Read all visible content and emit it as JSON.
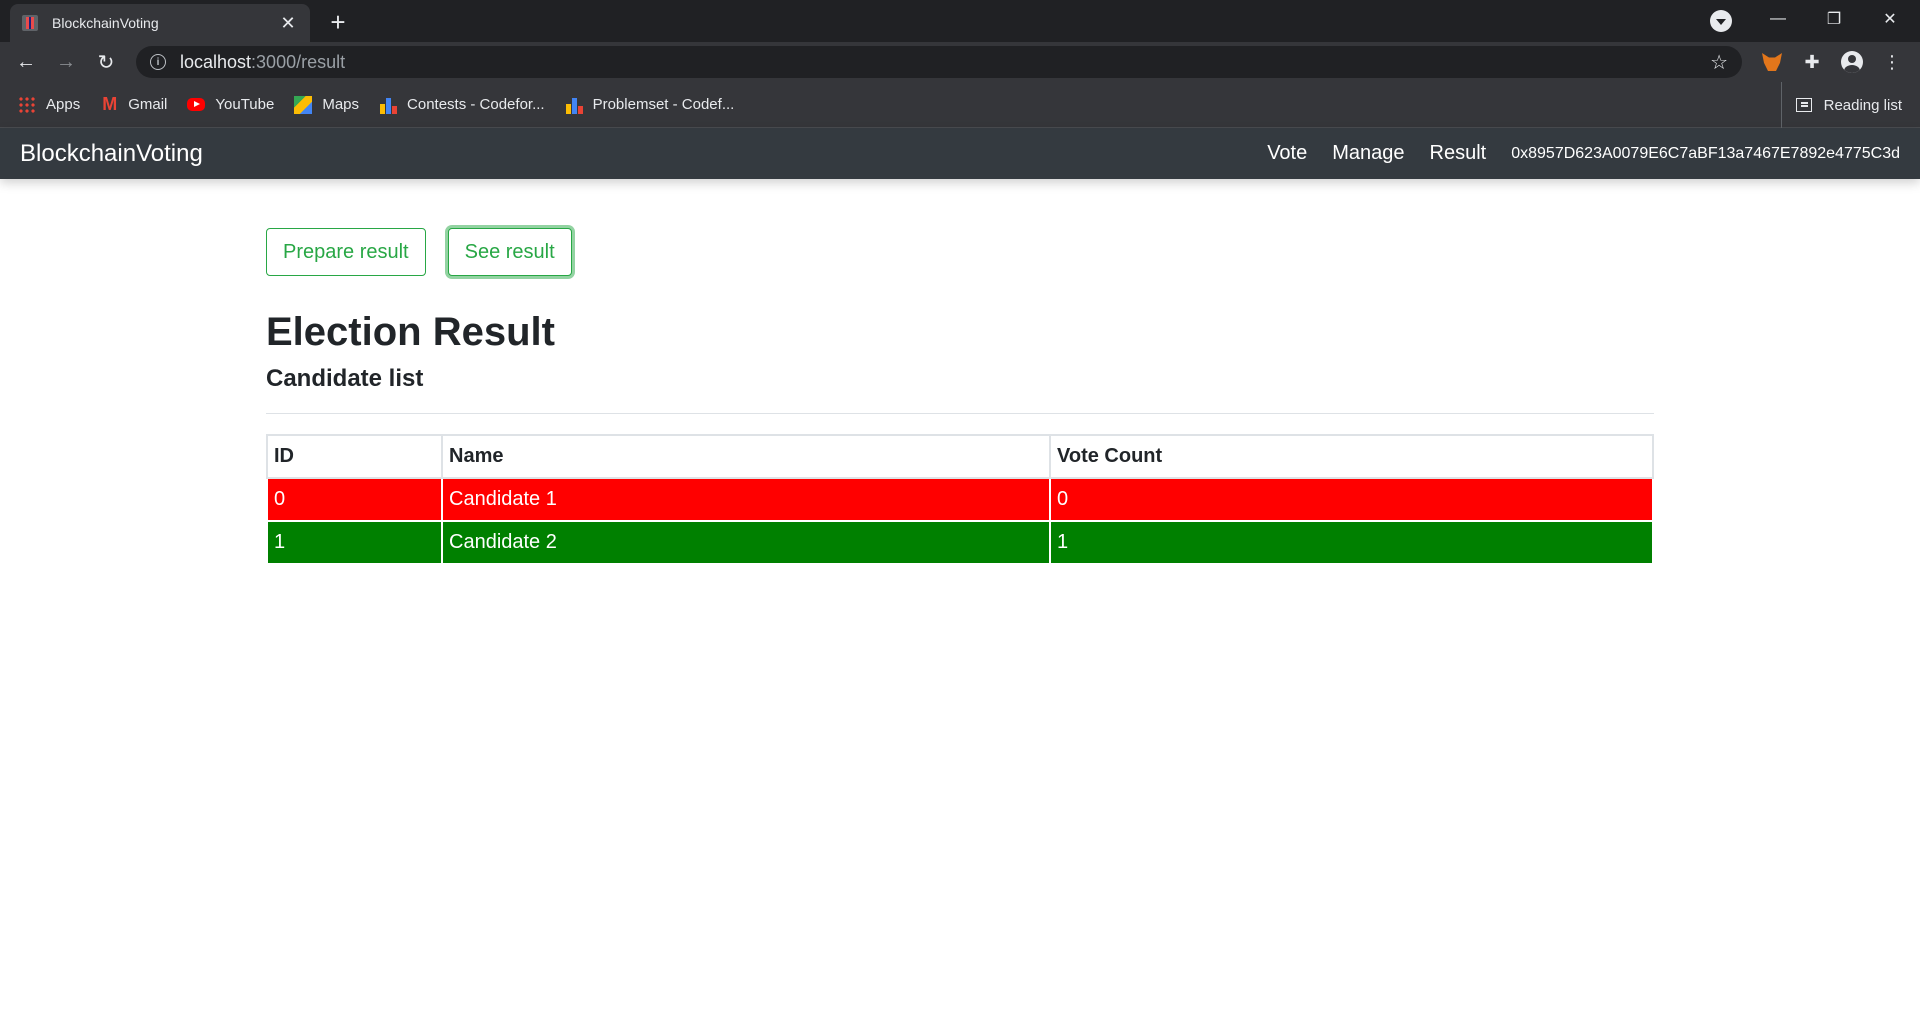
{
  "browser": {
    "tab_title": "BlockchainVoting",
    "new_tab_symbol": "+",
    "url_host": "localhost",
    "url_path": ":3000/result",
    "bookmarks": [
      {
        "label": "Apps",
        "icon": "apps-icon"
      },
      {
        "label": "Gmail",
        "icon": "gmail-icon"
      },
      {
        "label": "YouTube",
        "icon": "youtube-icon"
      },
      {
        "label": "Maps",
        "icon": "maps-icon"
      },
      {
        "label": "Contests - Codefor...",
        "icon": "codeforces-icon"
      },
      {
        "label": "Problemset - Codef...",
        "icon": "codeforces-icon"
      }
    ],
    "reading_list": "Reading list"
  },
  "navbar": {
    "brand": "BlockchainVoting",
    "links": [
      "Vote",
      "Manage",
      "Result"
    ],
    "account": "0x8957D623A0079E6C7aBF13a7467E7892e4775C3d"
  },
  "page": {
    "prepare_button": "Prepare result",
    "see_button": "See result",
    "title": "Election Result",
    "subtitle": "Candidate list"
  },
  "table": {
    "headers": [
      "ID",
      "Name",
      "Vote Count"
    ],
    "rows": [
      {
        "id": "0",
        "name": "Candidate 1",
        "votes": "0",
        "status": "lose"
      },
      {
        "id": "1",
        "name": "Candidate 2",
        "votes": "1",
        "status": "win"
      }
    ]
  },
  "colors": {
    "success": "#28a745",
    "lose_row": "#ff0000",
    "win_row": "#008000",
    "navbar": "#343a40"
  }
}
